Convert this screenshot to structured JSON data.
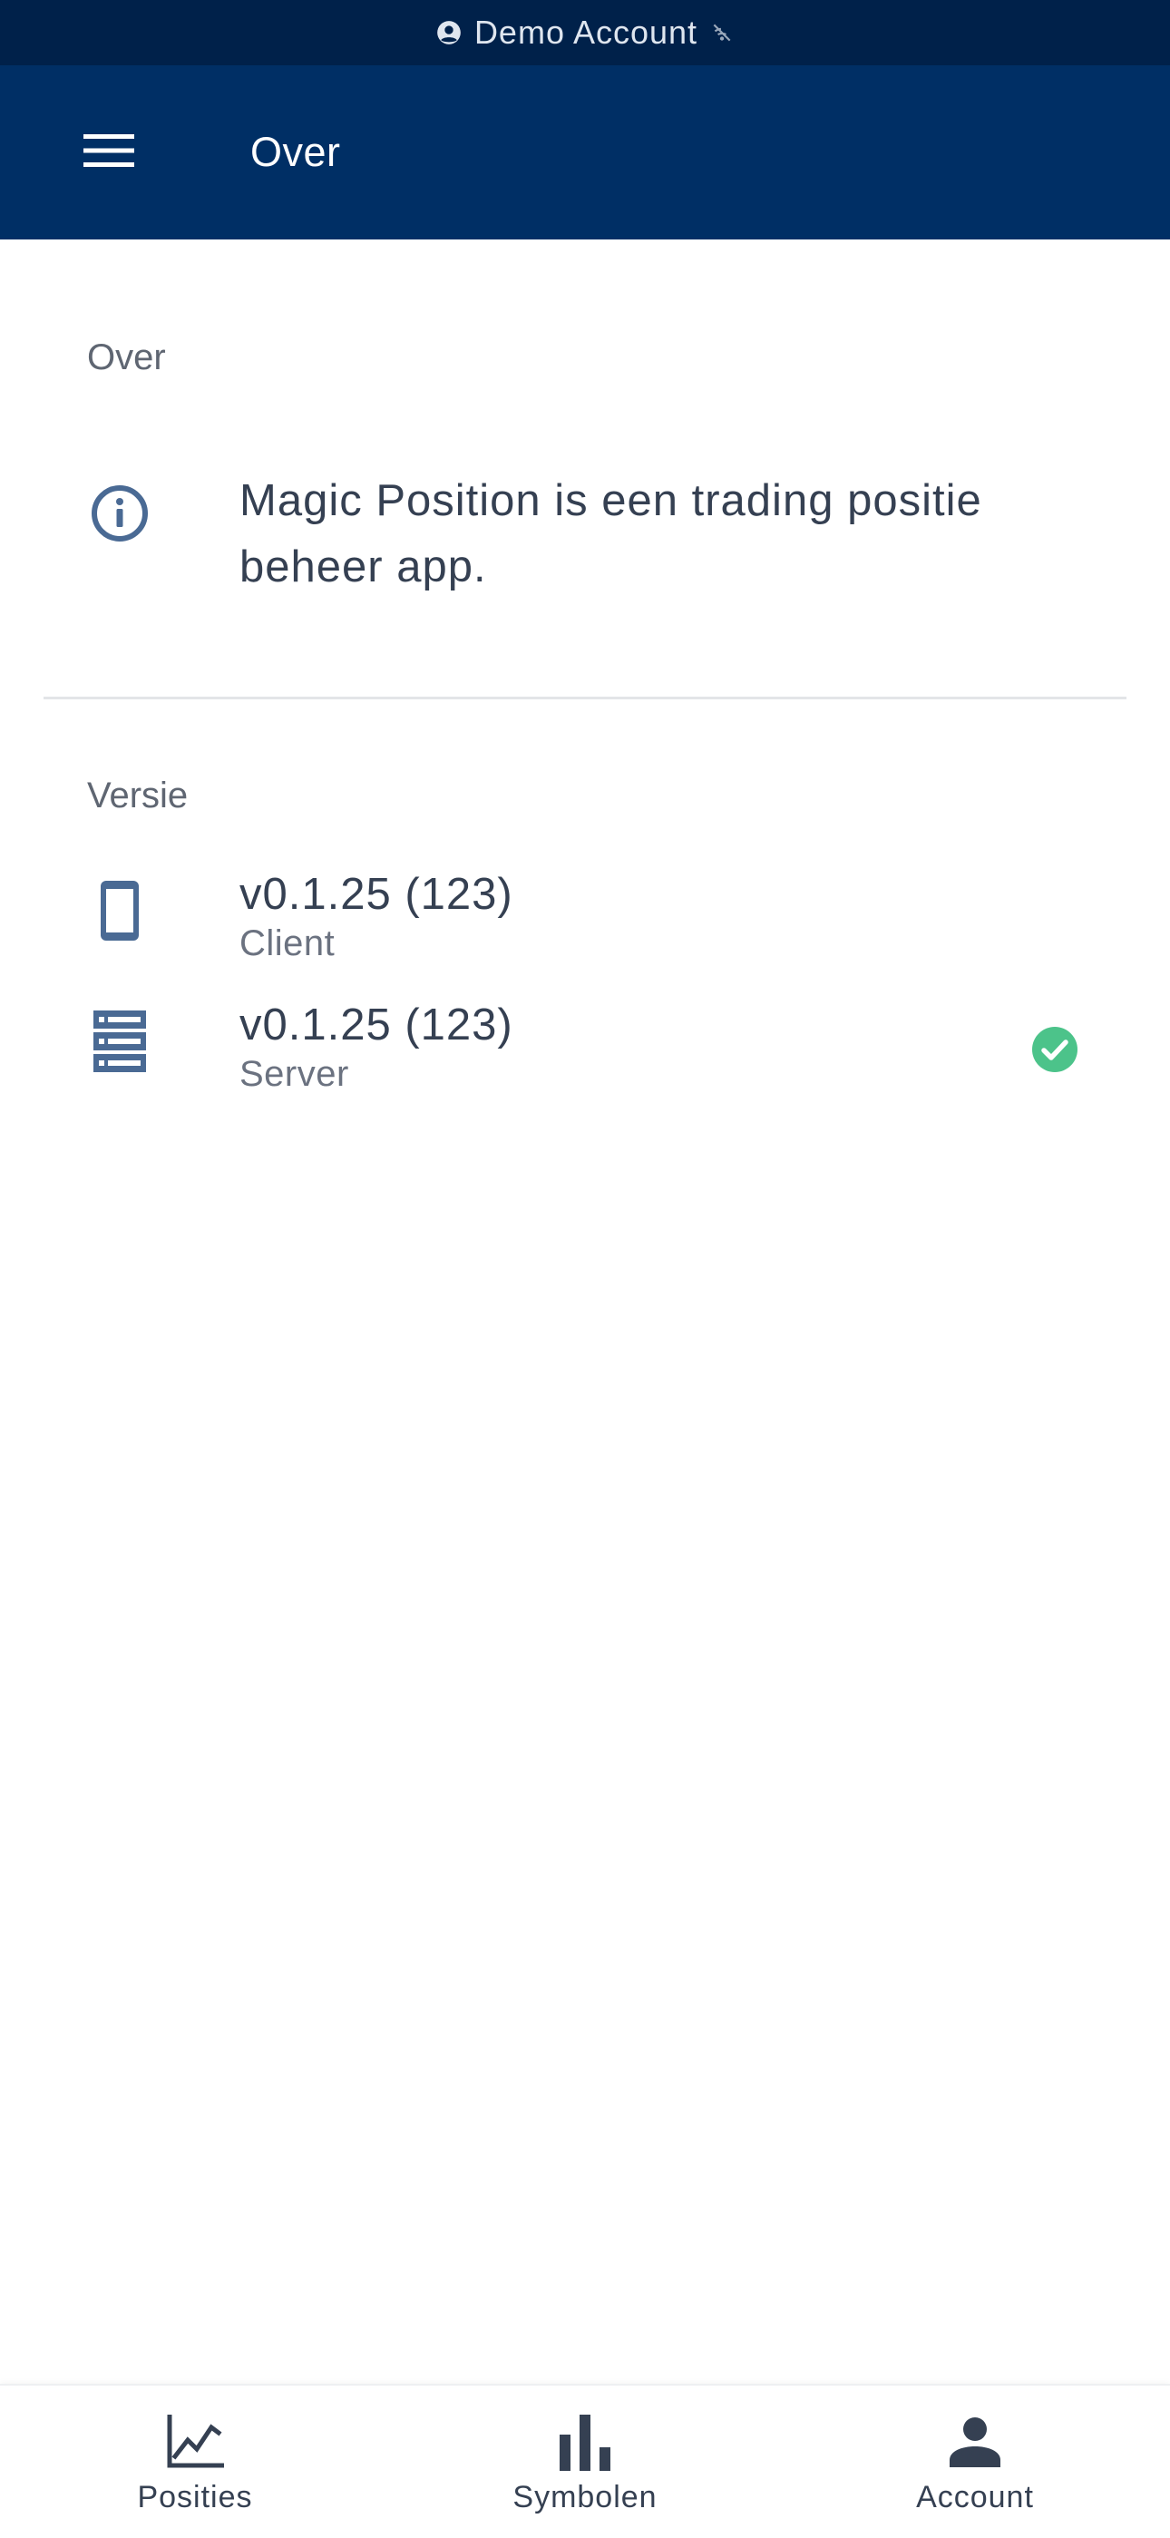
{
  "status_bar": {
    "account_label": "Demo Account",
    "account_icon": "account-circle-icon",
    "connection_icon": "wifi-off-icon"
  },
  "app_bar": {
    "menu_icon": "hamburger-menu-icon",
    "title": "Over"
  },
  "about_section": {
    "label": "Over",
    "icon": "info-icon",
    "text": "Magic Position is een trading positie beheer app."
  },
  "version_section": {
    "label": "Versie",
    "items": [
      {
        "icon": "smartphone-icon",
        "version": "v0.1.25 (123)",
        "caption": "Client"
      },
      {
        "icon": "server-icon",
        "version": "v0.1.25 (123)",
        "caption": "Server",
        "status_icon": "check-circle-icon",
        "status_color": "#4cc38a"
      }
    ]
  },
  "bottom_nav": {
    "items": [
      {
        "icon": "line-chart-icon",
        "label": "Posities"
      },
      {
        "icon": "bar-chart-icon",
        "label": "Symbolen"
      },
      {
        "icon": "person-icon",
        "label": "Account"
      }
    ]
  },
  "colors": {
    "status_bar_bg": "#00214a",
    "app_bar_bg": "#002f65",
    "icon_blue": "#4a6a94",
    "success_green": "#4cc38a",
    "text_primary": "#354052"
  }
}
